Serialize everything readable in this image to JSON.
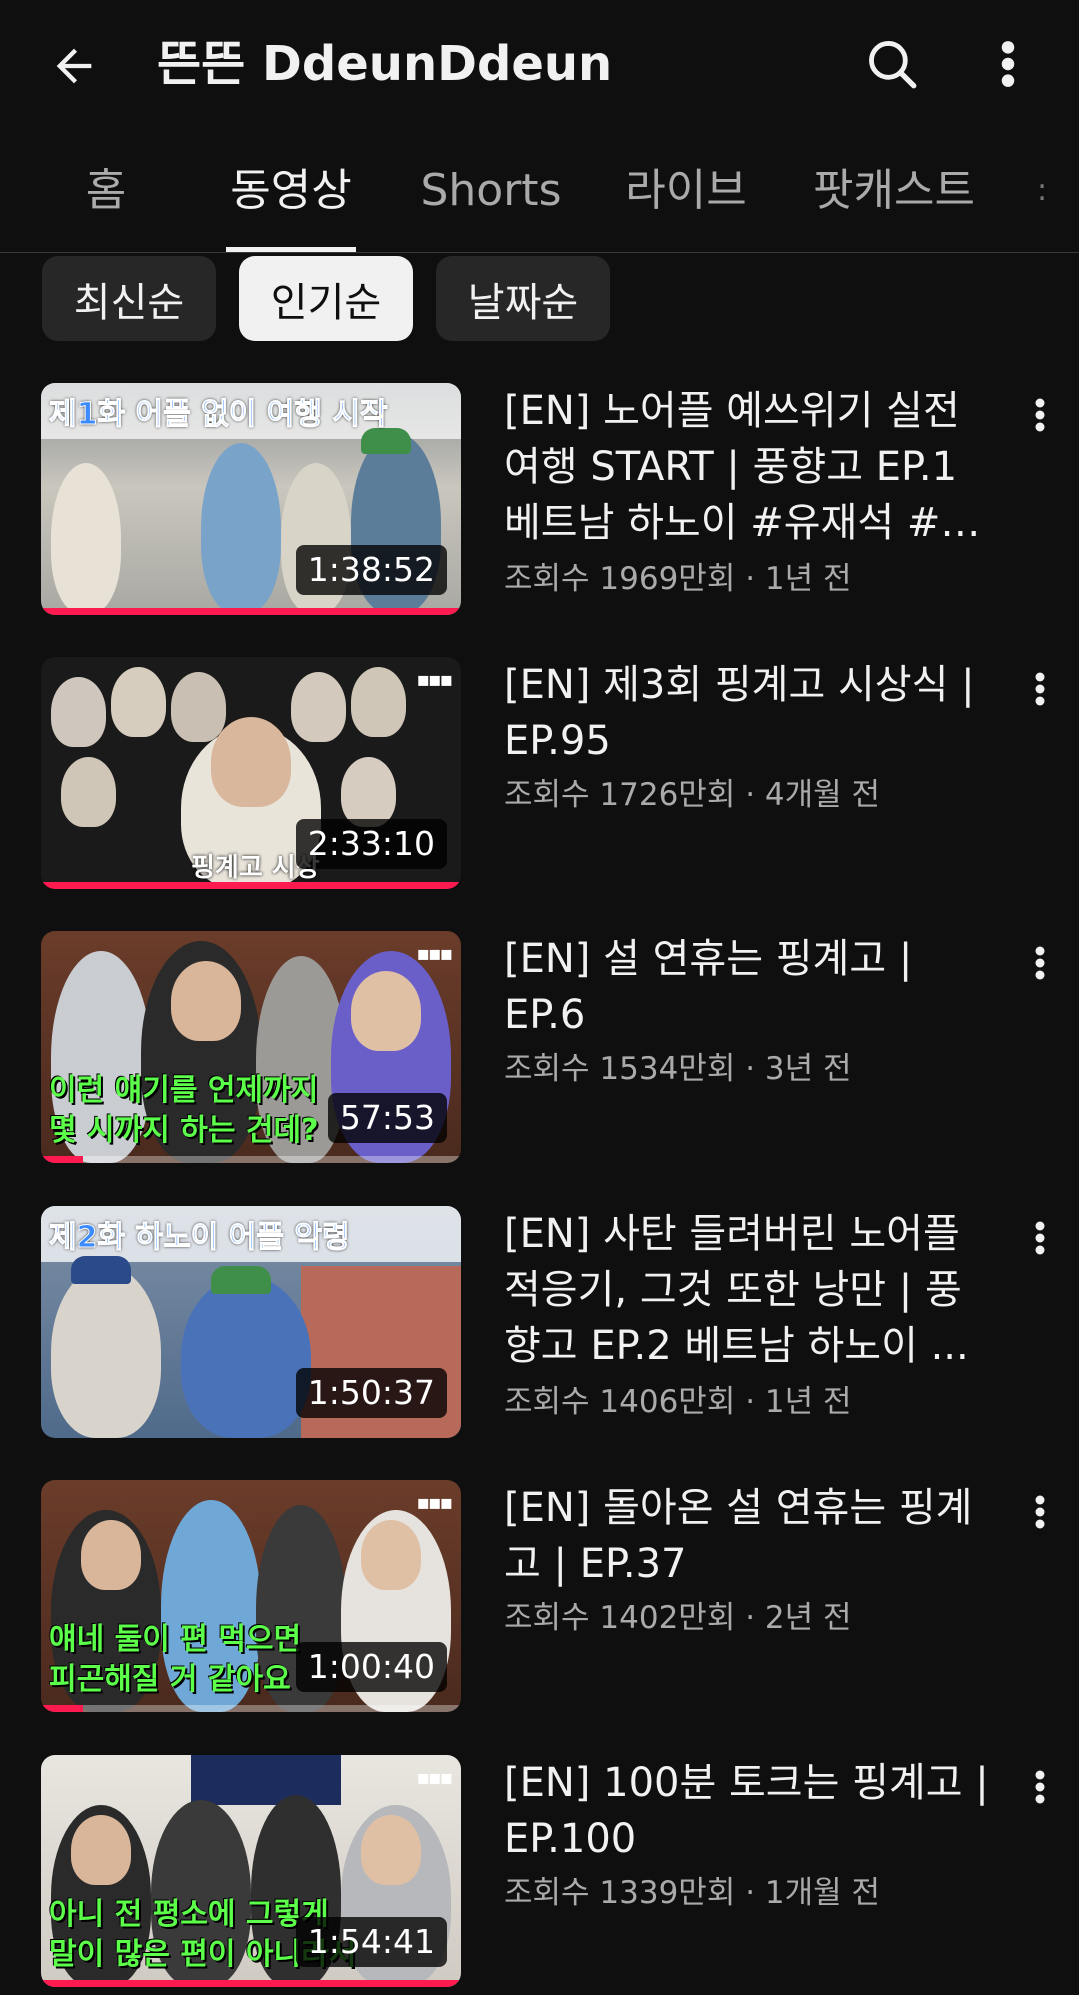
{
  "header": {
    "channel_title": "뜬뜬 DdeunDdeun",
    "back_icon": "arrow-left-icon",
    "search_icon": "search-icon",
    "more_icon": "more-vertical-icon"
  },
  "tabs": [
    {
      "label": "홈",
      "active": false
    },
    {
      "label": "동영상",
      "active": true
    },
    {
      "label": "Shorts",
      "active": false
    },
    {
      "label": "라이브",
      "active": false
    },
    {
      "label": "팟캐스트",
      "active": false
    }
  ],
  "sort_chips": [
    {
      "label": "최신순",
      "selected": false
    },
    {
      "label": "인기순",
      "selected": true
    },
    {
      "label": "날짜순",
      "selected": false
    }
  ],
  "videos": [
    {
      "title": "[EN] 노어플 예쓰위기 실전 여행 START | 풍향고 EP.1 베트남 하노이 #유재석 #황...",
      "meta": "조회수 1969만회 · 1년 전",
      "duration": "1:38:52",
      "thumb_caption": "제1화 어플 없이 여행 시작",
      "thumb_caption_2": "",
      "progress": 1.0
    },
    {
      "title": "[EN] 제3회 핑계고 시상식 | EP.95",
      "meta": "조회수 1726만회 · 4개월 전",
      "duration": "2:33:10",
      "thumb_caption": "핑계고 시상",
      "thumb_caption_2": "",
      "progress": 1.0
    },
    {
      "title": "[EN] 설 연휴는 핑계고 | EP.6",
      "meta": "조회수 1534만회 · 3년 전",
      "duration": "57:53",
      "thumb_caption": "이런 얘기를 언제까지",
      "thumb_caption_2": "몇 시까지 하는 건데?",
      "progress": 0.1
    },
    {
      "title": "[EN] 사탄 들려버린 노어플 적응기, 그것 또한 낭만 | 풍향고 EP.2 베트남 하노이 ...",
      "meta": "조회수 1406만회 · 1년 전",
      "duration": "1:50:37",
      "thumb_caption": "제2화 하노이 어플 악령",
      "thumb_caption_2": "",
      "progress": 0.0
    },
    {
      "title": "[EN] 돌아온 설 연휴는 핑계고 | EP.37",
      "meta": "조회수 1402만회 · 2년 전",
      "duration": "1:00:40",
      "thumb_caption": "얘네 둘이 편 먹으면",
      "thumb_caption_2": "피곤해질 거 같아요",
      "progress": 0.1
    },
    {
      "title": "[EN] 100분 토크는 핑계고 | EP.100",
      "meta": "조회수 1339만회 · 1개월 전",
      "duration": "1:54:41",
      "thumb_caption": "아니 전 평소에 그렇게",
      "thumb_caption_2": "말이 많은 편이 아니라서",
      "progress": 1.0
    }
  ],
  "colors": {
    "background": "#0f0f0f",
    "text_primary": "#f1f1f1",
    "text_secondary": "#aaaaaa",
    "chip_bg": "#272727",
    "progress_red": "#ff1a4f"
  }
}
